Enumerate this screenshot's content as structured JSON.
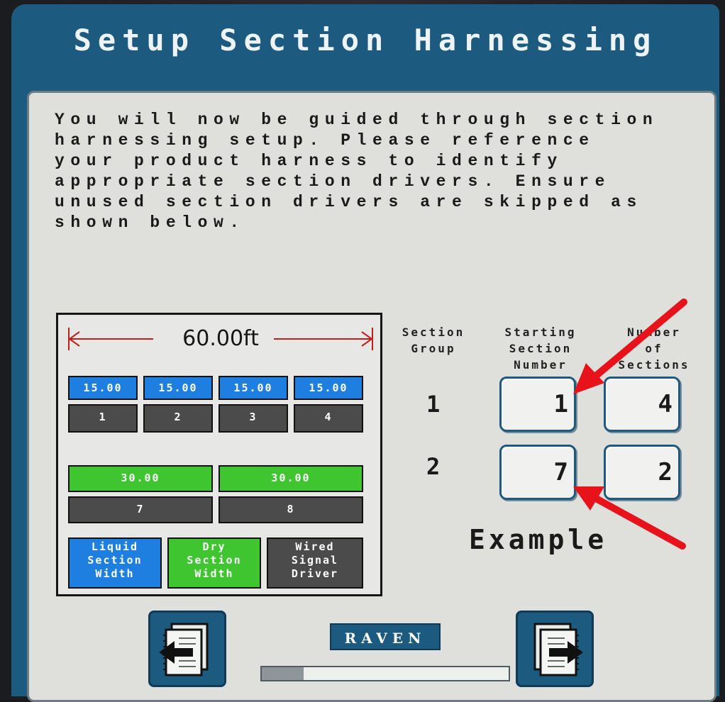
{
  "title": "Setup Section Harnessing",
  "intro_text": "You will now be guided through section\nharnessing setup. Please reference\nyour product harness to identify\nappropriate section drivers. Ensure\nunused section drivers are skipped as\nshown below.",
  "diagram": {
    "total_width": "60.00ft",
    "row1_widths": [
      "15.00",
      "15.00",
      "15.00",
      "15.00"
    ],
    "row1_drivers": [
      "1",
      "2",
      "3",
      "4"
    ],
    "row2_widths": [
      "30.00",
      "30.00"
    ],
    "row2_drivers": [
      "7",
      "8"
    ],
    "legend": {
      "liquid": [
        "Liquid",
        "Section",
        "Width"
      ],
      "dry": [
        "Dry",
        "Section",
        "Width"
      ],
      "wired": [
        "Wired",
        "Signal",
        "Driver"
      ]
    }
  },
  "table": {
    "col_section_group": [
      "Section",
      "Group"
    ],
    "col_starting_section": [
      "Starting",
      "Section",
      "Number"
    ],
    "col_number_of_sections": [
      "Number",
      "of",
      "Sections"
    ],
    "rows": [
      {
        "group": "1",
        "start": "1",
        "count": "4"
      },
      {
        "group": "2",
        "start": "7",
        "count": "2"
      }
    ]
  },
  "example_label": "Example",
  "brand": "RAVEN",
  "progress": 0.17,
  "colors": {
    "frame": "#1d5a80",
    "liquid": "#1f7fe0",
    "dry": "#3ec52f",
    "driver": "#4b4b4b",
    "annotation_arrow": "#e8121a"
  },
  "icons": {
    "back": "page-back-icon",
    "next": "page-next-icon"
  }
}
